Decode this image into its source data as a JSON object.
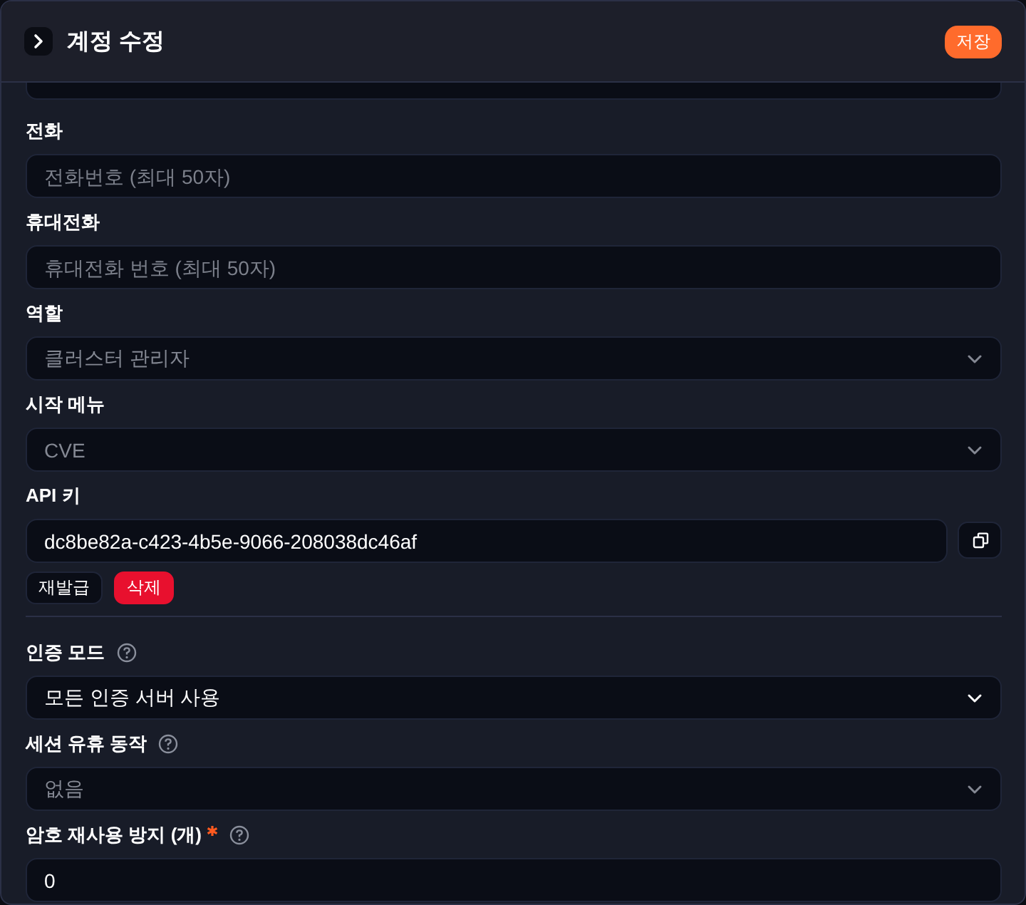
{
  "header": {
    "title": "계정 수정",
    "save_button": "저장"
  },
  "fields": [
    {
      "kind": "text",
      "label": "전화",
      "placeholder": "전화번호 (최대 50자)",
      "help": false,
      "required": false
    },
    {
      "kind": "text",
      "label": "휴대전화",
      "placeholder": "휴대전화 번호 (최대 50자)",
      "help": false,
      "required": false
    },
    {
      "kind": "select",
      "label": "역할",
      "value": "클러스터 관리자",
      "disabled": true,
      "help": false,
      "required": false
    },
    {
      "kind": "select",
      "label": "시작 메뉴",
      "value": "CVE",
      "disabled": true,
      "help": false,
      "required": false
    },
    {
      "kind": "apikey",
      "label": "API 키",
      "value": "dc8be82a-c423-4b5e-9066-208038dc46af",
      "help": false,
      "required": false,
      "buttons": [
        {
          "label": "재발급",
          "danger": false
        },
        {
          "label": "삭제",
          "danger": true
        }
      ]
    },
    {
      "kind": "divider"
    },
    {
      "kind": "select",
      "label": "인증 모드",
      "value": "모든 인증 서버 사용",
      "disabled": false,
      "help": true,
      "required": false
    },
    {
      "kind": "select",
      "label": "세션 유휴 동작",
      "value": "없음",
      "disabled": true,
      "help": true,
      "required": false
    },
    {
      "kind": "text",
      "label": "암호 재사용 방지 (개)",
      "value": "0",
      "help": true,
      "required": true
    }
  ]
}
